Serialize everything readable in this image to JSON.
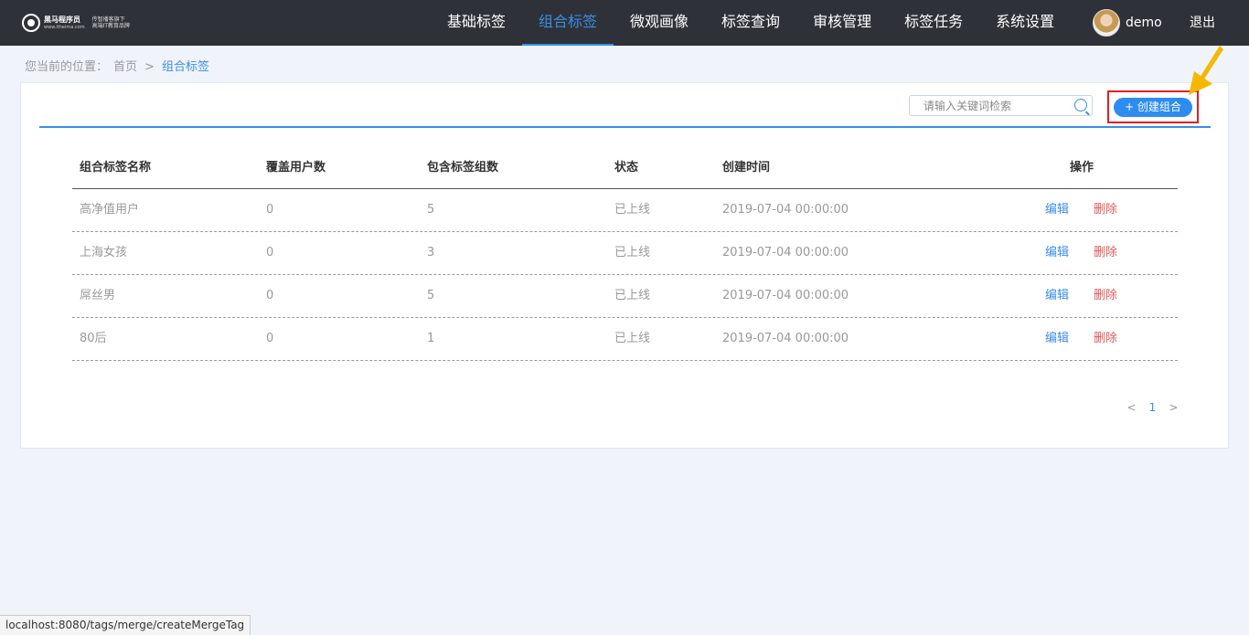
{
  "logo": {
    "line1": "黑马程序员",
    "line2": "www.itheima.com",
    "slogan1": "传智播客旗下",
    "slogan2": "高端IT教育品牌"
  },
  "nav": {
    "items": [
      {
        "label": "基础标签"
      },
      {
        "label": "组合标签"
      },
      {
        "label": "微观画像"
      },
      {
        "label": "标签查询"
      },
      {
        "label": "审核管理"
      },
      {
        "label": "标签任务"
      },
      {
        "label": "系统设置"
      }
    ],
    "active": "组合标签"
  },
  "user": {
    "name": "demo",
    "logout": "退出"
  },
  "breadcrumb": {
    "prefix": "您当前的位置：",
    "home": "首页",
    "separator": ">",
    "current": "组合标签"
  },
  "toolbar": {
    "search_placeholder": "请输入关键词检索",
    "create_label": "+ 创建组合"
  },
  "table": {
    "headers": [
      "组合标签名称",
      "覆盖用户数",
      "包含标签组数",
      "状态",
      "创建时间",
      "操作"
    ],
    "rows": [
      {
        "name": "高净值用户",
        "users": "0",
        "groups": "5",
        "status": "已上线",
        "created": "2019-07-04 00:00:00",
        "edit": "编辑",
        "delete": "删除"
      },
      {
        "name": "上海女孩",
        "users": "0",
        "groups": "3",
        "status": "已上线",
        "created": "2019-07-04 00:00:00",
        "edit": "编辑",
        "delete": "删除"
      },
      {
        "name": "屌丝男",
        "users": "0",
        "groups": "5",
        "status": "已上线",
        "created": "2019-07-04 00:00:00",
        "edit": "编辑",
        "delete": "删除"
      },
      {
        "name": "80后",
        "users": "0",
        "groups": "1",
        "status": "已上线",
        "created": "2019-07-04 00:00:00",
        "edit": "编辑",
        "delete": "删除"
      }
    ]
  },
  "pagination": {
    "prev": "<",
    "page": "1",
    "next": ">"
  },
  "statusbar": {
    "url": "localhost:8080/tags/merge/createMergeTag"
  },
  "colors": {
    "accent": "#3a8ee6",
    "topbar": "#2e3238",
    "danger": "#e05a5a",
    "highlight_box": "#e02020",
    "arrow": "#f5b800"
  }
}
